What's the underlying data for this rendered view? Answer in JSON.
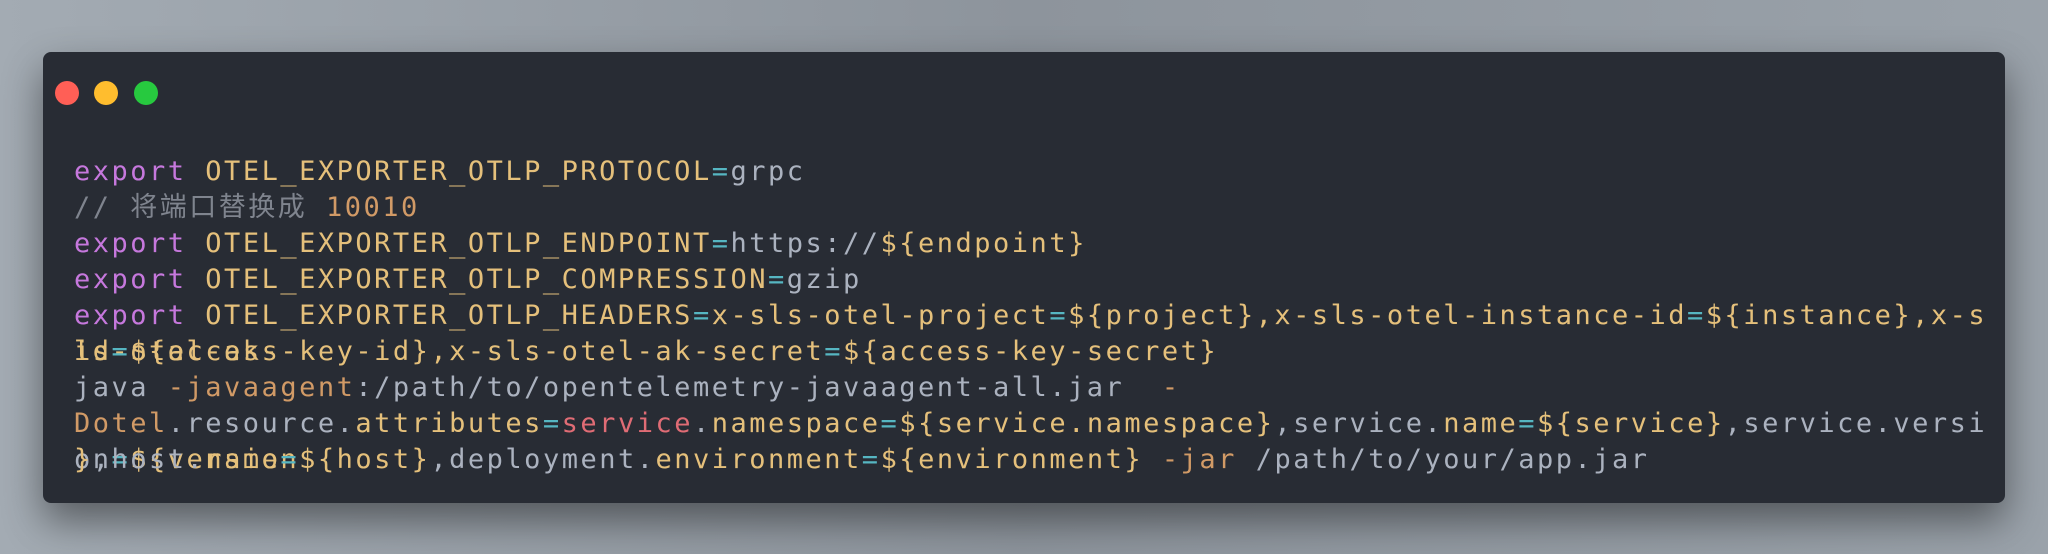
{
  "window": {
    "buttons": {
      "close_color": "#ff5f56",
      "minimize_color": "#ffbd2e",
      "maximize_color": "#27c93f"
    }
  },
  "code": {
    "lines": [
      {
        "tokens": [
          {
            "t": "export",
            "c": "purple"
          },
          {
            "t": " OTEL_EXPORTER_OTLP_PROTOCOL",
            "c": "yellow"
          },
          {
            "t": "=",
            "c": "cyan"
          },
          {
            "t": "grpc",
            "c": "gray"
          }
        ]
      },
      {
        "tokens": [
          {
            "t": "// 将端口替换成 ",
            "c": "comment"
          },
          {
            "t": "10010",
            "c": "orange"
          }
        ]
      },
      {
        "tokens": [
          {
            "t": "export",
            "c": "purple"
          },
          {
            "t": " OTEL_EXPORTER_OTLP_ENDPOINT",
            "c": "yellow"
          },
          {
            "t": "=",
            "c": "cyan"
          },
          {
            "t": "https://",
            "c": "gray"
          },
          {
            "t": "${endpoint}",
            "c": "yellow"
          }
        ]
      },
      {
        "tokens": [
          {
            "t": "export",
            "c": "purple"
          },
          {
            "t": " OTEL_EXPORTER_OTLP_COMPRESSION",
            "c": "yellow"
          },
          {
            "t": "=",
            "c": "cyan"
          },
          {
            "t": "gzip",
            "c": "gray"
          }
        ]
      },
      {
        "tokens": [
          {
            "t": "export",
            "c": "purple"
          },
          {
            "t": " OTEL_EXPORTER_OTLP_HEADERS",
            "c": "yellow"
          },
          {
            "t": "=",
            "c": "cyan"
          },
          {
            "t": "x-sls-otel-project",
            "c": "yellow"
          },
          {
            "t": "=",
            "c": "cyan"
          },
          {
            "t": "${project},x-sls-otel-instance-id",
            "c": "yellow"
          },
          {
            "t": "=",
            "c": "cyan"
          },
          {
            "t": "${instance},x-sls-otel-ak-",
            "c": "yellow"
          }
        ]
      },
      {
        "tokens": [
          {
            "t": "id",
            "c": "yellow"
          },
          {
            "t": "=",
            "c": "cyan"
          },
          {
            "t": "${access-key-id},x-sls-otel-ak-secret",
            "c": "yellow"
          },
          {
            "t": "=",
            "c": "cyan"
          },
          {
            "t": "${access-key-secret}",
            "c": "yellow"
          }
        ]
      },
      {
        "tokens": [
          {
            "t": "java ",
            "c": "gray"
          },
          {
            "t": "-javaagent",
            "c": "orange"
          },
          {
            "t": ":/path/to/opentelemetry-javaagent-all.jar  ",
            "c": "gray"
          },
          {
            "t": "-",
            "c": "orange"
          }
        ]
      },
      {
        "tokens": [
          {
            "t": "Dotel",
            "c": "orange"
          },
          {
            "t": ".resource.",
            "c": "gray"
          },
          {
            "t": "attributes",
            "c": "yellow"
          },
          {
            "t": "=",
            "c": "cyan"
          },
          {
            "t": "service",
            "c": "red"
          },
          {
            "t": ".",
            "c": "gray"
          },
          {
            "t": "namespace",
            "c": "yellow"
          },
          {
            "t": "=",
            "c": "cyan"
          },
          {
            "t": "${service.namespace}",
            "c": "yellow"
          },
          {
            "t": ",service.",
            "c": "gray"
          },
          {
            "t": "name",
            "c": "yellow"
          },
          {
            "t": "=",
            "c": "cyan"
          },
          {
            "t": "${service}",
            "c": "yellow"
          },
          {
            "t": ",service.version",
            "c": "gray"
          },
          {
            "t": "=",
            "c": "cyan"
          },
          {
            "t": "${version",
            "c": "yellow"
          }
        ]
      },
      {
        "tokens": [
          {
            "t": "}",
            "c": "yellow"
          },
          {
            "t": ",host.",
            "c": "gray"
          },
          {
            "t": "name",
            "c": "yellow"
          },
          {
            "t": "=",
            "c": "cyan"
          },
          {
            "t": "${host}",
            "c": "yellow"
          },
          {
            "t": ",deployment.",
            "c": "gray"
          },
          {
            "t": "environment",
            "c": "yellow"
          },
          {
            "t": "=",
            "c": "cyan"
          },
          {
            "t": "${environment}",
            "c": "yellow"
          },
          {
            "t": " ",
            "c": "gray"
          },
          {
            "t": "-jar",
            "c": "orange"
          },
          {
            "t": " /path/to/your/app.jar",
            "c": "gray"
          }
        ]
      }
    ]
  }
}
